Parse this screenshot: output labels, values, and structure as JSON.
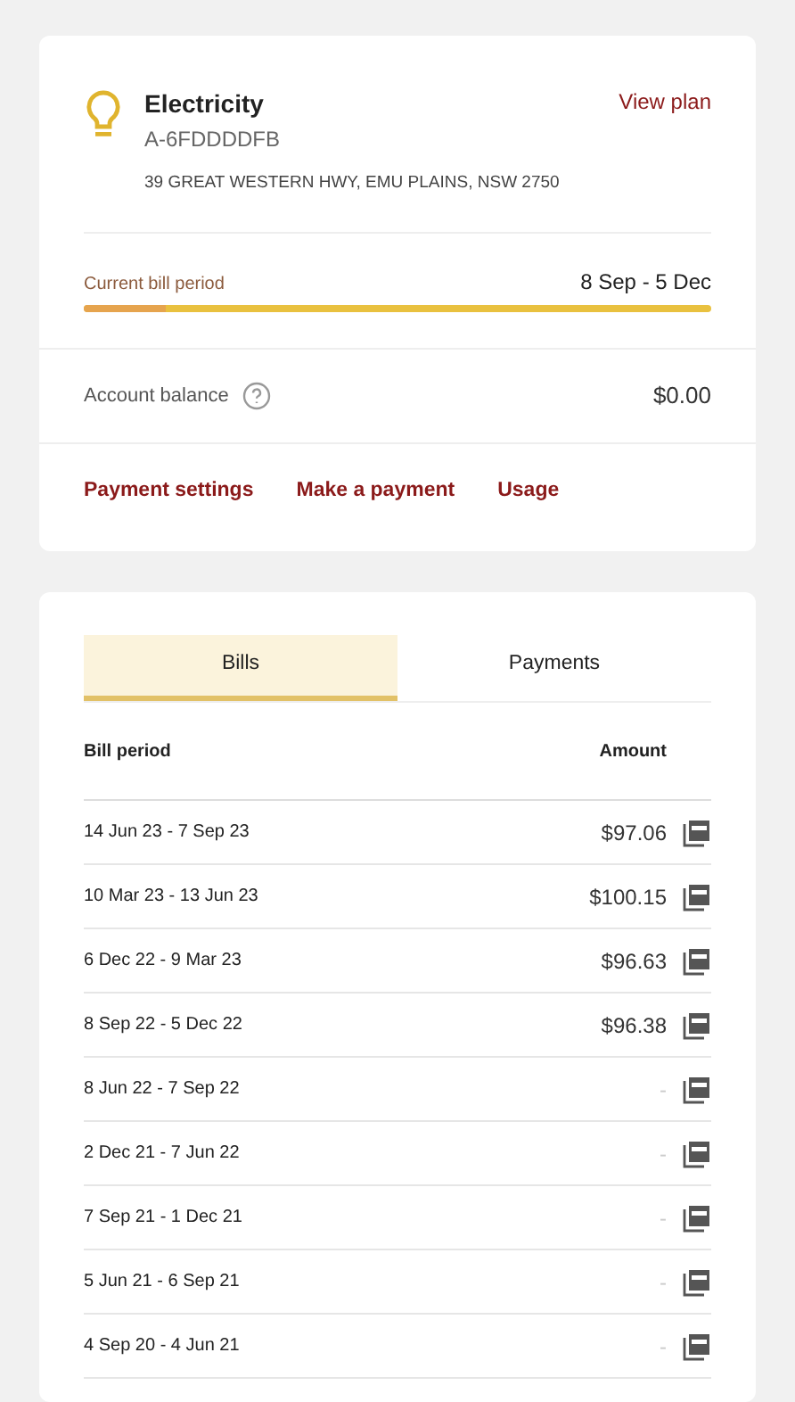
{
  "account": {
    "title": "Electricity",
    "number": "A-6FDDDDFB",
    "address": "39 GREAT WESTERN HWY, EMU PLAINS, NSW 2750",
    "view_plan": "View plan"
  },
  "bill_period": {
    "label": "Current bill period",
    "dates": "8 Sep - 5 Dec",
    "level": 0.13
  },
  "balance": {
    "label": "Account balance",
    "amount": "$0.00"
  },
  "links": [
    "Payment settings",
    "Make a payment",
    "Usage"
  ],
  "tabs": [
    {
      "label": "Bills",
      "selected": true
    },
    {
      "label": "Payments",
      "selected": false
    }
  ],
  "table": {
    "columns": [
      "Bill period",
      "Amount"
    ],
    "rows": [
      {
        "period": "14 Jun 23 - 7 Sep 23",
        "amount": "$97.06"
      },
      {
        "period": "10 Mar 23 - 13 Jun 23",
        "amount": "$100.15"
      },
      {
        "period": "6 Dec 22 - 9 Mar 23",
        "amount": "$96.63"
      },
      {
        "period": "8 Sep 22 - 5 Dec 22",
        "amount": "$96.38"
      },
      {
        "period": "8 Jun 22 - 7 Sep 22",
        "amount": "-"
      },
      {
        "period": "2 Dec 21 - 7 Jun 22",
        "amount": "-"
      },
      {
        "period": "7 Sep 21 - 1 Dec 21",
        "amount": "-"
      },
      {
        "period": "5 Jun 21 - 6 Sep 21",
        "amount": "-"
      },
      {
        "period": "4 Sep 20 - 4 Jun 21",
        "amount": "-"
      }
    ]
  }
}
